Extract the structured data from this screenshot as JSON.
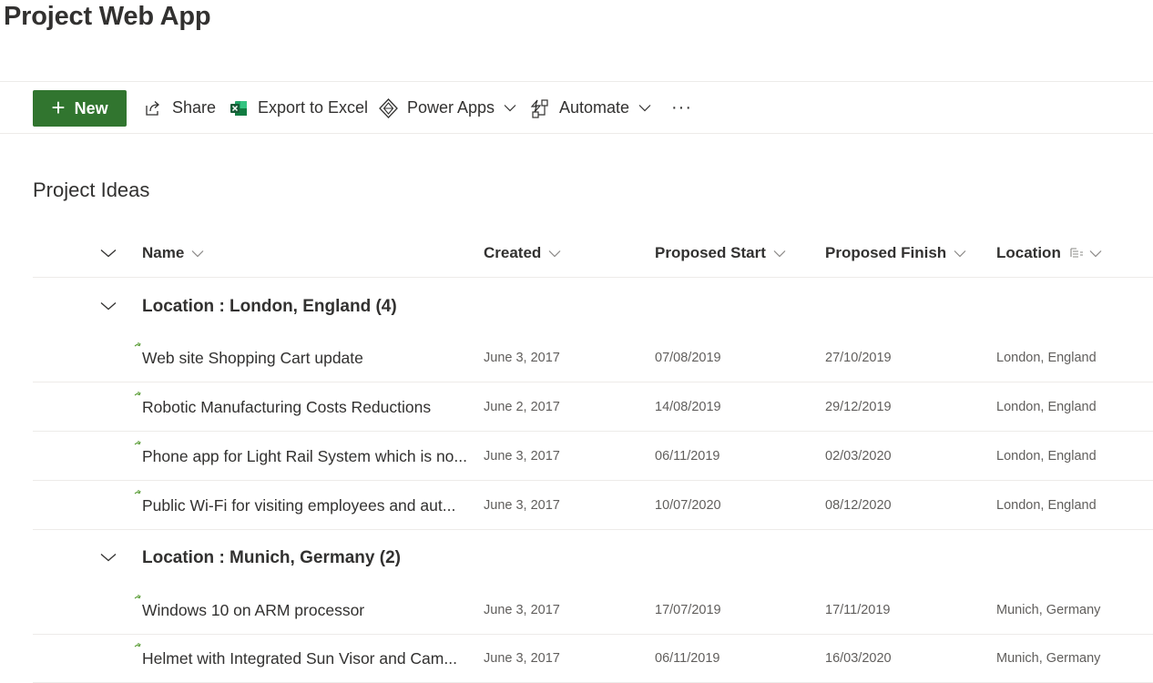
{
  "app": {
    "title": "Project Web App"
  },
  "toolbar": {
    "new_label": "New",
    "share_label": "Share",
    "export_label": "Export to Excel",
    "powerapps_label": "Power Apps",
    "automate_label": "Automate",
    "more_label": "···"
  },
  "list": {
    "title": "Project Ideas",
    "columns": {
      "name": "Name",
      "created": "Created",
      "proposed_start": "Proposed Start",
      "proposed_finish": "Proposed Finish",
      "location": "Location"
    },
    "groups": [
      {
        "label": "Location : London, England (4)",
        "items": [
          {
            "name": "Web site Shopping Cart update",
            "created": "June 3, 2017",
            "start": "07/08/2019",
            "finish": "27/10/2019",
            "location": "London, England"
          },
          {
            "name": "Robotic Manufacturing Costs Reductions",
            "created": "June 2, 2017",
            "start": "14/08/2019",
            "finish": "29/12/2019",
            "location": "London, England"
          },
          {
            "name": "Phone app for Light Rail System which is no...",
            "created": "June 3, 2017",
            "start": "06/11/2019",
            "finish": "02/03/2020",
            "location": "London, England"
          },
          {
            "name": "Public Wi-Fi for visiting employees and aut...",
            "created": "June 3, 2017",
            "start": "10/07/2020",
            "finish": "08/12/2020",
            "location": "London, England"
          }
        ]
      },
      {
        "label": "Location : Munich, Germany (2)",
        "items": [
          {
            "name": "Windows 10 on ARM processor",
            "created": "June 3, 2017",
            "start": "17/07/2019",
            "finish": "17/11/2019",
            "location": "Munich, Germany"
          },
          {
            "name": "Helmet with Integrated Sun Visor and Cam...",
            "created": "June 3, 2017",
            "start": "06/11/2019",
            "finish": "16/03/2020",
            "location": "Munich, Germany"
          }
        ]
      }
    ]
  },
  "colors": {
    "accent_green": "#31752f",
    "text": "#323130",
    "secondary_text": "#605e5c",
    "divider": "#edebe9"
  }
}
